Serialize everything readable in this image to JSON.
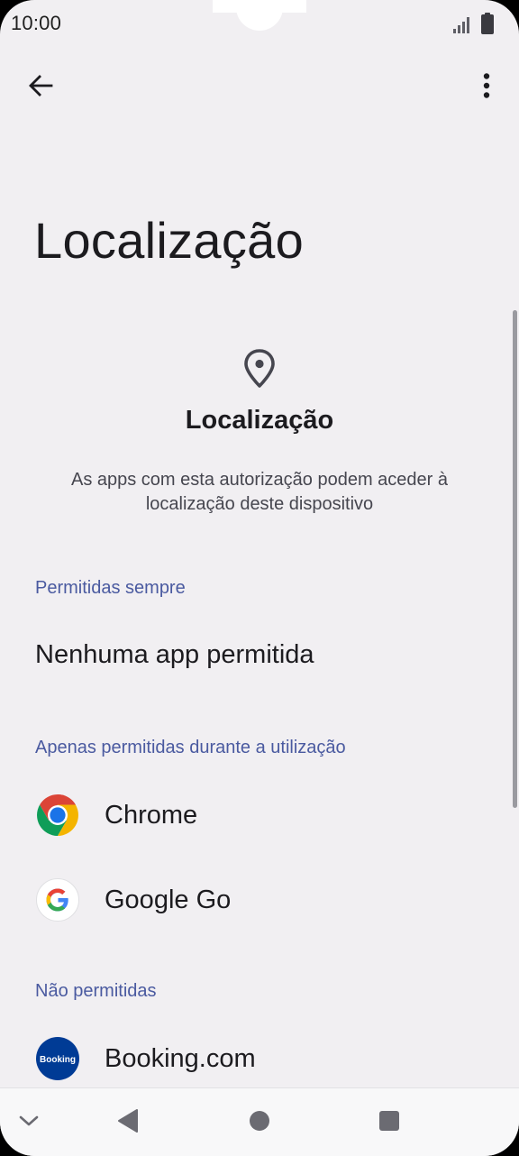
{
  "status_bar": {
    "time": "10:00",
    "icons": [
      "signal-icon",
      "battery-icon"
    ]
  },
  "toolbar": {
    "back_icon": "arrow-back-icon",
    "more_icon": "more-vert-icon"
  },
  "page": {
    "title": "Localização"
  },
  "hero": {
    "icon": "location-pin-icon",
    "title": "Localização",
    "description": "As apps com esta autorização podem aceder à localização deste dispositivo"
  },
  "sections": {
    "always": {
      "header": "Permitidas sempre",
      "empty_text": "Nenhuma app permitida"
    },
    "while_using": {
      "header": "Apenas permitidas durante a utilização",
      "apps": [
        {
          "name": "Chrome",
          "icon": "chrome-icon"
        },
        {
          "name": "Google Go",
          "icon": "google-go-icon"
        }
      ]
    },
    "not_allowed": {
      "header": "Não permitidas",
      "apps": [
        {
          "name": "Booking.com",
          "icon": "booking-icon",
          "icon_text": "Booking"
        }
      ]
    }
  },
  "nav_bar": {
    "buttons": [
      "chevron-down-icon",
      "nav-back-icon",
      "nav-home-icon",
      "nav-recents-icon"
    ]
  },
  "colors": {
    "background": "#f1eff2",
    "section_header": "#4a5aa0",
    "text_primary": "#1c1b1f",
    "booking_blue": "#003b95"
  }
}
